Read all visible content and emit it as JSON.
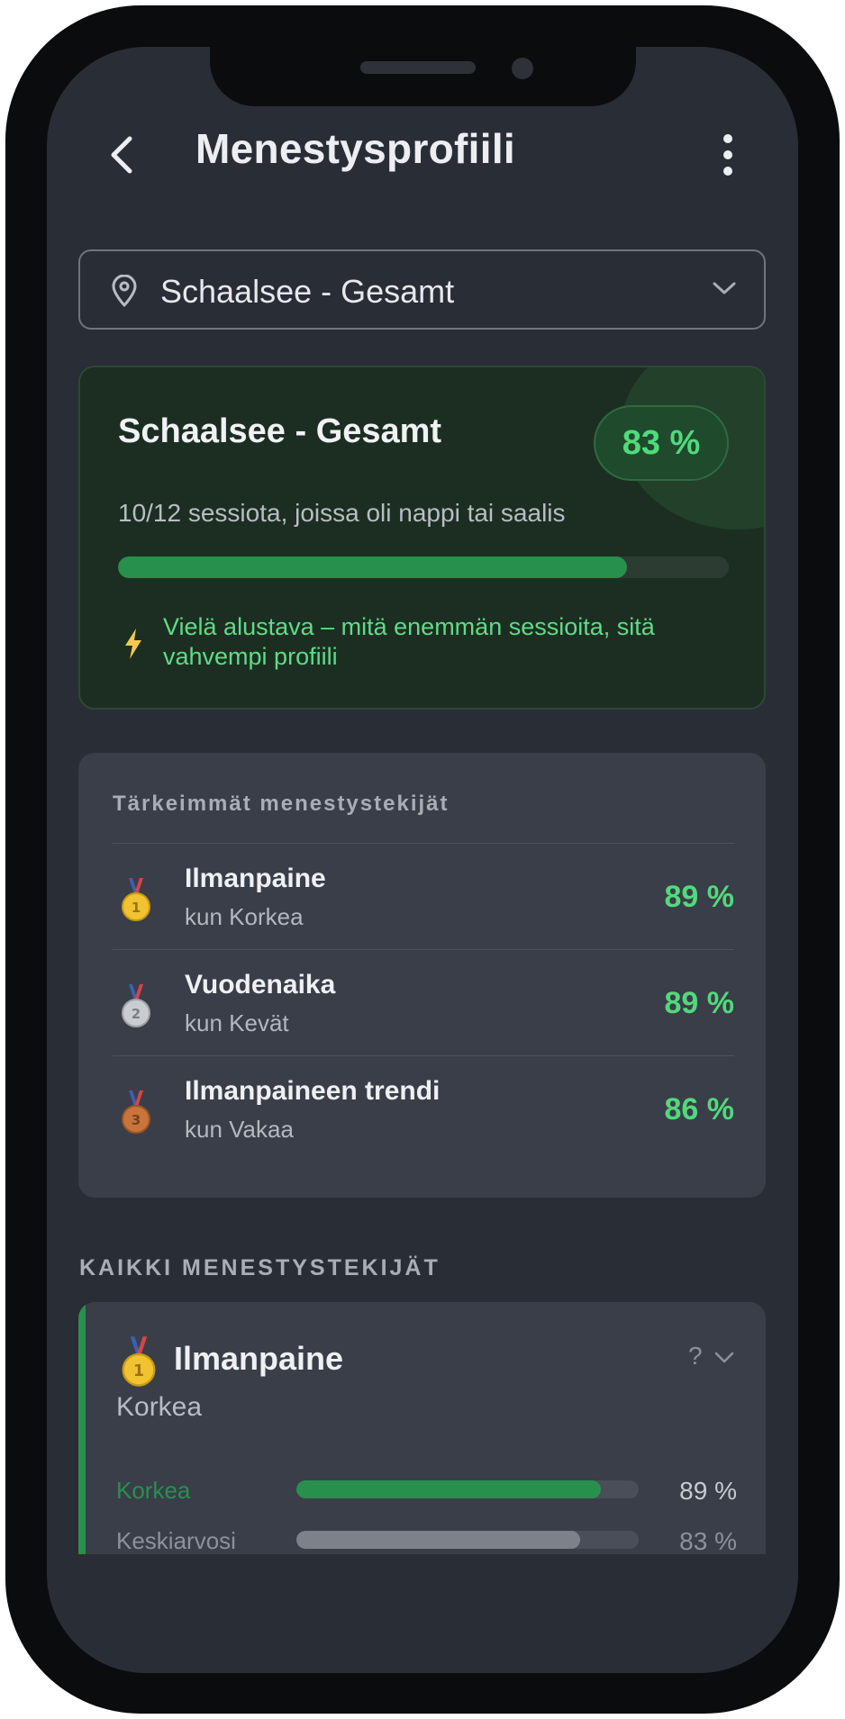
{
  "header": {
    "title": "Menestysprofiili"
  },
  "location_select": {
    "value": "Schaalsee - Gesamt"
  },
  "summary": {
    "title": "Schaalsee - Gesamt",
    "badge": "83 %",
    "sessions_text": "10/12 sessiota, joissa oli nappi tai saalis",
    "progress_fraction": 0.833,
    "note": "Vielä alustava – mitä enemmän sessioita, sitä vahvempi profiili"
  },
  "top_factors": {
    "heading": "Tärkeimmät menestystekijät",
    "items": [
      {
        "rank": 1,
        "medal": "gold-medal-icon",
        "name": "Ilmanpaine",
        "condition": "kun Korkea",
        "percent": "89 %"
      },
      {
        "rank": 2,
        "medal": "silver-medal-icon",
        "name": "Vuodenaika",
        "condition": "kun Kevät",
        "percent": "89 %"
      },
      {
        "rank": 3,
        "medal": "bronze-medal-icon",
        "name": "Ilmanpaineen trendi",
        "condition": "kun Vakaa",
        "percent": "86 %"
      }
    ]
  },
  "all_factors": {
    "heading": "KAIKKI MENESTYSTEKIJÄT",
    "items": [
      {
        "name": "Ilmanpaine",
        "help": "?",
        "value": "Korkea",
        "bars": [
          {
            "label": "Korkea",
            "percent": "89 %",
            "fraction": 0.89
          },
          {
            "label": "Keskiarvosi",
            "percent": "83 %",
            "fraction": 0.83
          }
        ]
      }
    ]
  },
  "colors": {
    "background": "#292d36",
    "card": "#3a3e48",
    "accent_green": "#52d97c",
    "bar_green": "#27904d",
    "summary_bg": "#1c2e22"
  }
}
